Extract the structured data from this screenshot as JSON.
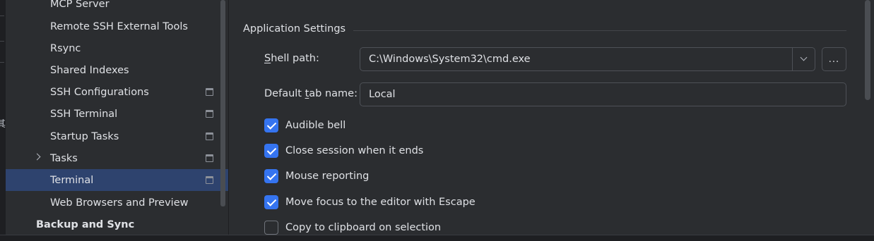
{
  "edge": {
    "glyph": "其"
  },
  "sidebar": {
    "items": [
      {
        "label": "MCP Server",
        "project": false,
        "selected": false
      },
      {
        "label": "Remote SSH External Tools",
        "project": false,
        "selected": false
      },
      {
        "label": "Rsync",
        "project": false,
        "selected": false
      },
      {
        "label": "Shared Indexes",
        "project": false,
        "selected": false
      },
      {
        "label": "SSH Configurations",
        "project": true,
        "selected": false
      },
      {
        "label": "SSH Terminal",
        "project": true,
        "selected": false
      },
      {
        "label": "Startup Tasks",
        "project": true,
        "selected": false
      },
      {
        "label": "Tasks",
        "project": true,
        "selected": false,
        "expandable": true
      },
      {
        "label": "Terminal",
        "project": true,
        "selected": true
      },
      {
        "label": "Web Browsers and Preview",
        "project": false,
        "selected": false
      },
      {
        "label": "Backup and Sync",
        "project": false,
        "selected": false,
        "group": true
      }
    ]
  },
  "main": {
    "section_title": "Application Settings",
    "shell_path": {
      "label_mnemonic": "S",
      "label_rest": "hell path:",
      "value": "C:\\Windows\\System32\\cmd.exe",
      "browse_label": "..."
    },
    "default_tab_name": {
      "label_before": "Default ",
      "label_mnemonic": "t",
      "label_after": "ab name:",
      "value": "Local"
    },
    "options": [
      {
        "label": "Audible bell",
        "checked": true
      },
      {
        "label": "Close session when it ends",
        "checked": true
      },
      {
        "label": "Mouse reporting",
        "checked": true
      },
      {
        "label": "Move focus to the editor with Escape",
        "checked": true
      },
      {
        "label": "Copy to clipboard on selection",
        "checked": false
      }
    ]
  },
  "colors": {
    "background": "#2b2d30",
    "selection": "#2e436e",
    "accent": "#3574f0",
    "text": "#dfe1e5"
  }
}
